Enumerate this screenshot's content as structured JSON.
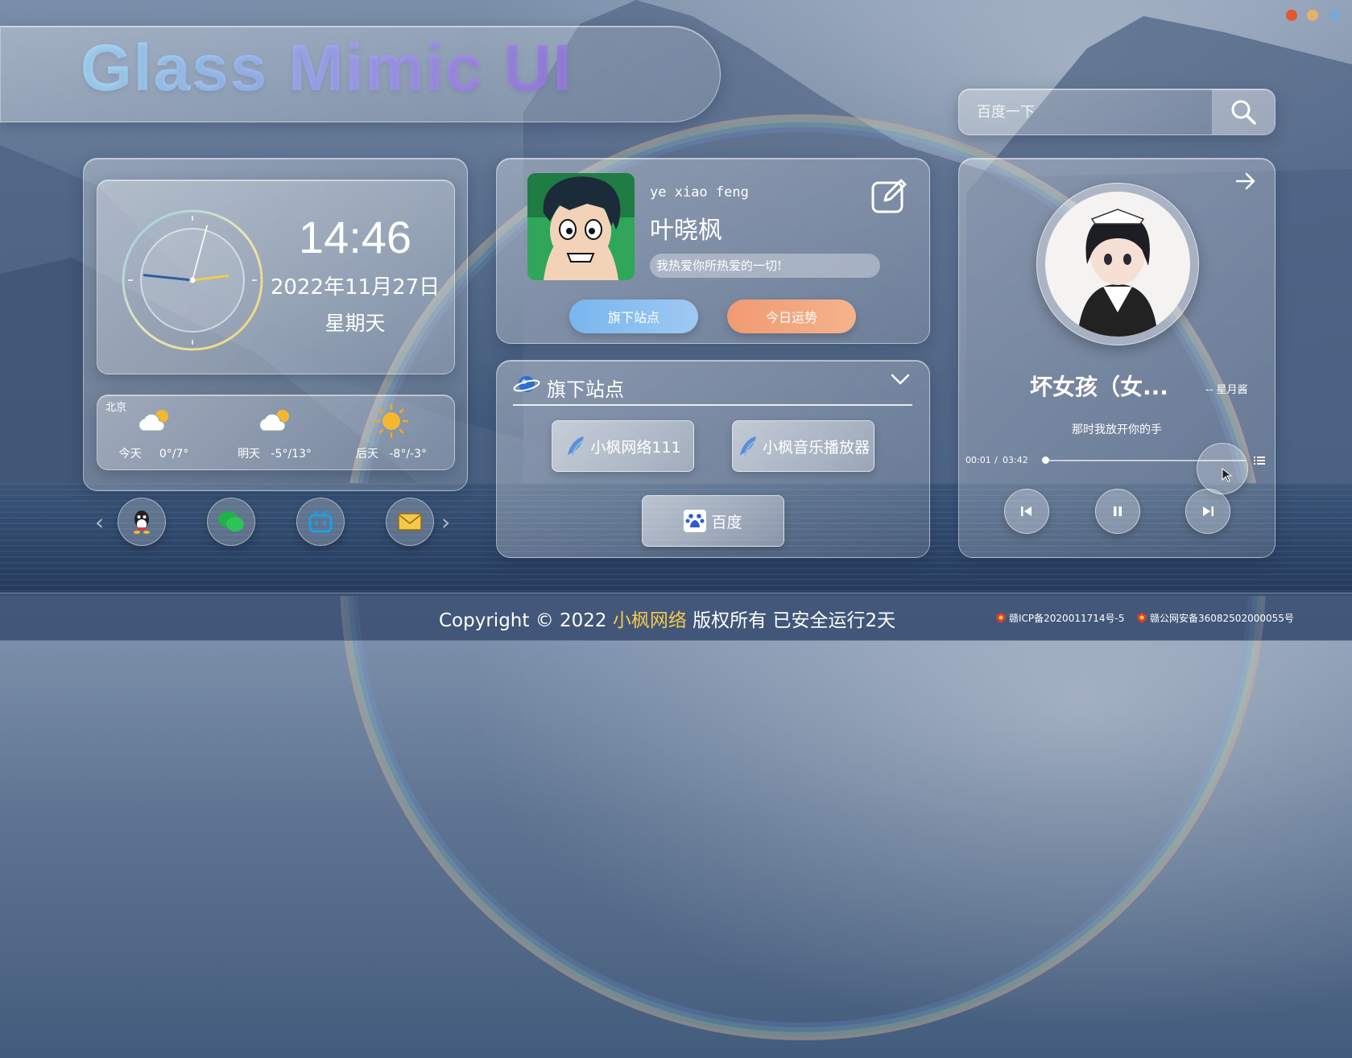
{
  "title": "Glass Mimic UI",
  "window_dots": [
    "#e2572e",
    "#e0b36b",
    "#7aa7d6"
  ],
  "search": {
    "placeholder": "百度一下",
    "icon": "search-icon"
  },
  "clock": {
    "time": "14:46",
    "date": "2022年11月27日",
    "weekday": "星期天",
    "hour_hand_angle_deg": 443,
    "minute_hand_angle_deg": 276,
    "second_hand_angle_deg": 15
  },
  "weather": {
    "city": "北京",
    "days": [
      {
        "label": "今天",
        "temp": "0°/7°",
        "icon": "cloudy-sun-icon"
      },
      {
        "label": "明天",
        "temp": "-5°/13°",
        "icon": "cloudy-sun-icon"
      },
      {
        "label": "后天",
        "temp": "-8°/-3°",
        "icon": "sun-icon"
      }
    ]
  },
  "social": [
    {
      "name": "qq",
      "icon": "qq-icon"
    },
    {
      "name": "wechat",
      "icon": "wechat-icon"
    },
    {
      "name": "bilibili",
      "icon": "bilibili-icon"
    },
    {
      "name": "email",
      "icon": "mail-icon"
    }
  ],
  "profile": {
    "username": "ye xiao feng",
    "display_name": "叶晓枫",
    "motto": "我热爱你所热爱的一切!",
    "btn_sites": "旗下站点",
    "btn_fortune": "今日运势"
  },
  "sites": {
    "header": "旗下站点",
    "items": [
      {
        "label": "小枫网络111",
        "icon": "feather-icon"
      },
      {
        "label": "小枫音乐播放器",
        "icon": "feather-icon"
      },
      {
        "label": "百度",
        "icon": "baidu-icon"
      }
    ]
  },
  "music": {
    "song": "坏女孩（女...",
    "artist": "-- 星月酱",
    "lyric": "那时我放开你的手",
    "elapsed": "00:01",
    "total": "03:42",
    "progress": 0.005
  },
  "footer": {
    "copyright_prefix": "Copyright © 2022",
    "brand": "小枫网络",
    "copyright_suffix": "版权所有 已安全运行2天",
    "icp": "赣ICP备2020011714号-5",
    "police": "赣公网安备36082502000055号",
    "brand_color": "#f2c94c"
  }
}
